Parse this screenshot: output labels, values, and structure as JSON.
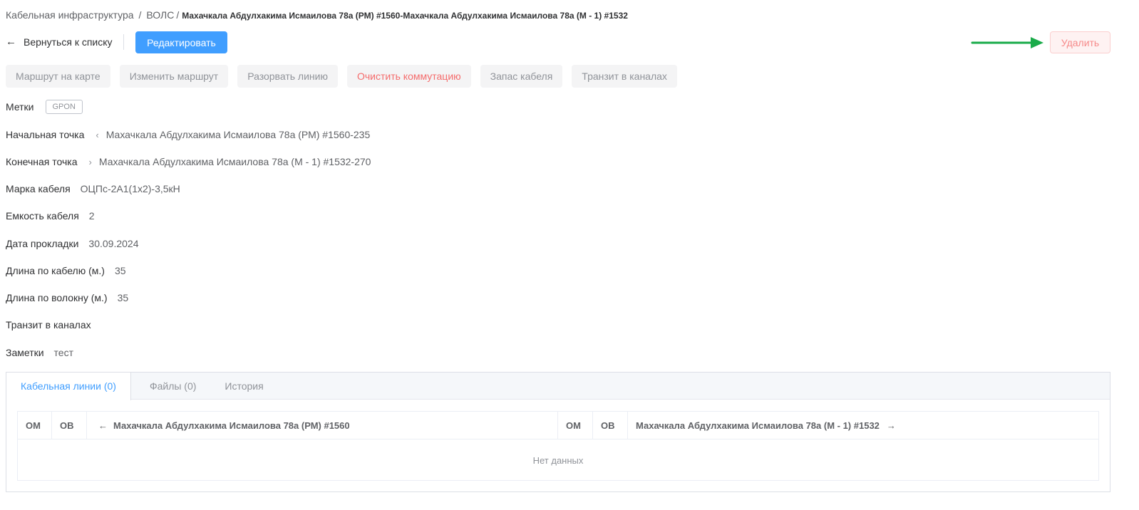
{
  "breadcrumb": {
    "root": "Кабельная инфраструктура",
    "sep1": "/",
    "section": "ВОЛС",
    "sep2": "/",
    "current": "Махачкала Абдулхакима Исмаилова 78а (РМ) #1560-Махачкала Абдулхакима Исмаилова 78а (М - 1) #1532"
  },
  "header": {
    "back_arrow": "←",
    "back_label": "Вернуться к списку",
    "edit_label": "Редактировать",
    "delete_label": "Удалить"
  },
  "actions": [
    "Маршрут на карте",
    "Изменить маршрут",
    "Разорвать линию",
    "Очистить коммутацию",
    "Запас кабеля",
    "Транзит в каналах"
  ],
  "info": {
    "tags_label": "Метки",
    "tag": "GPON",
    "start_label": "Начальная точка",
    "start_value": "Махачкала Абдулхакима Исмаилова 78а (РМ) #1560-235",
    "end_label": "Конечная точка",
    "end_value": "Махачкала Абдулхакима Исмаилова 78а (М - 1) #1532-270",
    "brand_label": "Марка кабеля",
    "brand_value": "ОЦПс-2А1(1х2)-3,5кН",
    "capacity_label": "Емкость кабеля",
    "capacity_value": "2",
    "date_label": "Дата прокладки",
    "date_value": "30.09.2024",
    "cable_len_label": "Длина по кабелю (м.)",
    "cable_len_value": "35",
    "fiber_len_label": "Длина по волокну (м.)",
    "fiber_len_value": "35",
    "transit_label": "Транзит в каналах",
    "notes_label": "Заметки",
    "notes_value": "тест"
  },
  "tabs": [
    "Кабельная линии (0)",
    "Файлы (0)",
    "История"
  ],
  "table": {
    "col_om1": "ОМ",
    "col_ob1": "ОВ",
    "col_left_arrow": "←",
    "col_left": "Махачкала Абдулхакима Исмаилова 78а (РМ) #1560",
    "col_om2": "ОМ",
    "col_ob2": "ОВ",
    "col_right": "Махачкала Абдулхакима Исмаилова 78а (М - 1) #1532",
    "col_right_arrow": "→",
    "empty": "Нет данных"
  },
  "colors": {
    "primary": "#409eff",
    "danger": "#f56c6c",
    "annotation_arrow": "#1aab4a"
  }
}
